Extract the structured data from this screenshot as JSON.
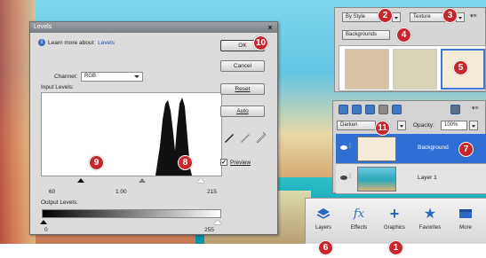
{
  "levels_dialog": {
    "title": "Levels",
    "close_glyph": "×",
    "learn_text": "Learn more about:",
    "learn_link": "Levels",
    "channel_label": "Channel:",
    "channel_value": "RGB",
    "input_levels_label": "Input Levels:",
    "input_black": "60",
    "input_gamma": "1.00",
    "input_white": "215",
    "output_levels_label": "Output Levels:",
    "output_black": "0",
    "output_white": "255",
    "buttons": {
      "ok": "OK",
      "cancel": "Cancel",
      "reset": "Reset",
      "auto": "Auto"
    },
    "preview_label": "Preview",
    "preview_checked": true
  },
  "graphics_panel": {
    "by_style": "By Style",
    "texture": "Texture",
    "backgrounds": "Backgrounds",
    "menu_glyph": "▾≡",
    "thumb_colors": [
      "#d8c2a4",
      "#d9d3b7",
      "#f4ecd8"
    ]
  },
  "layers_panel": {
    "blend_mode": "Darken",
    "opacity_label": "Opacity:",
    "opacity_value": "100%",
    "menu_glyph": "▾≡",
    "layers": [
      {
        "name": "Background",
        "selected": true
      },
      {
        "name": "Layer 1",
        "selected": false
      }
    ]
  },
  "dock": {
    "items": [
      "Layers",
      "Effects",
      "Graphics",
      "Favorites",
      "More"
    ]
  },
  "callouts": {
    "c1": "1",
    "c2": "2",
    "c3": "3",
    "c4": "4",
    "c5": "5",
    "c6": "6",
    "c7": "7",
    "c8": "8",
    "c9": "9",
    "c10": "10",
    "c11": "11"
  },
  "colors": {
    "callout": "#c8262d",
    "selection": "#2f6ed3",
    "link": "#1c4fb3"
  }
}
